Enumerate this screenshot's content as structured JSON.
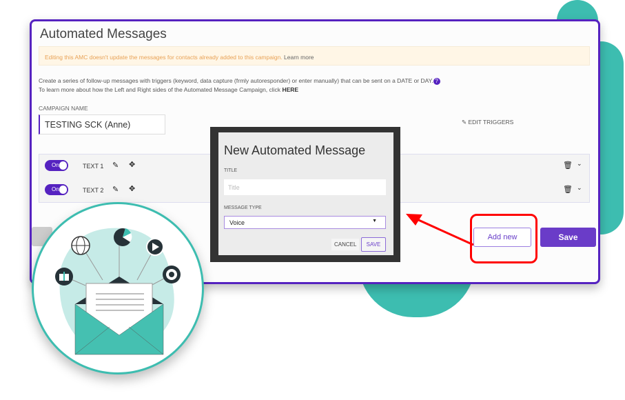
{
  "colors": {
    "accent": "#5522c0",
    "teal": "#3dbdb0",
    "warning_text": "#e8a256",
    "highlight": "#ff0000"
  },
  "page": {
    "title": "Automated Messages",
    "alert": {
      "text": "Editing this AMC doesn't update the messages for contacts already added to this campaign.",
      "link": "Learn more"
    },
    "description_line1": "Create a series of follow-up messages with triggers (keyword, data capture (frmly autoresponder) or enter manually) that can be sent on a DATE or DAY.",
    "help_icon": "?",
    "description_line2": "To learn more about how the Left and Right sides of the Automated Message Campaign, click",
    "description_link": "HERE",
    "campaign_name_label": "CAMPAIGN NAME",
    "campaign_name_value": "TESTING SCK (Anne)",
    "edit_triggers": "EDIT TRIGGERS",
    "messages": [
      {
        "toggle": "On",
        "label": "TEXT 1"
      },
      {
        "toggle": "On",
        "label": "TEXT 2"
      }
    ],
    "add_new": "Add new",
    "save": "Save"
  },
  "modal": {
    "title": "New Automated Message",
    "title_label": "TITLE",
    "title_placeholder": "Title",
    "type_label": "MESSAGE TYPE",
    "type_value": "Voice",
    "cancel": "CANCEL",
    "save": "SAVE"
  },
  "icons": [
    "pencil-icon",
    "move-icon",
    "trash-icon",
    "chevron-down-icon",
    "globe-icon",
    "pie-chart-icon",
    "play-icon",
    "gift-icon",
    "target-icon",
    "envelope-icon"
  ]
}
